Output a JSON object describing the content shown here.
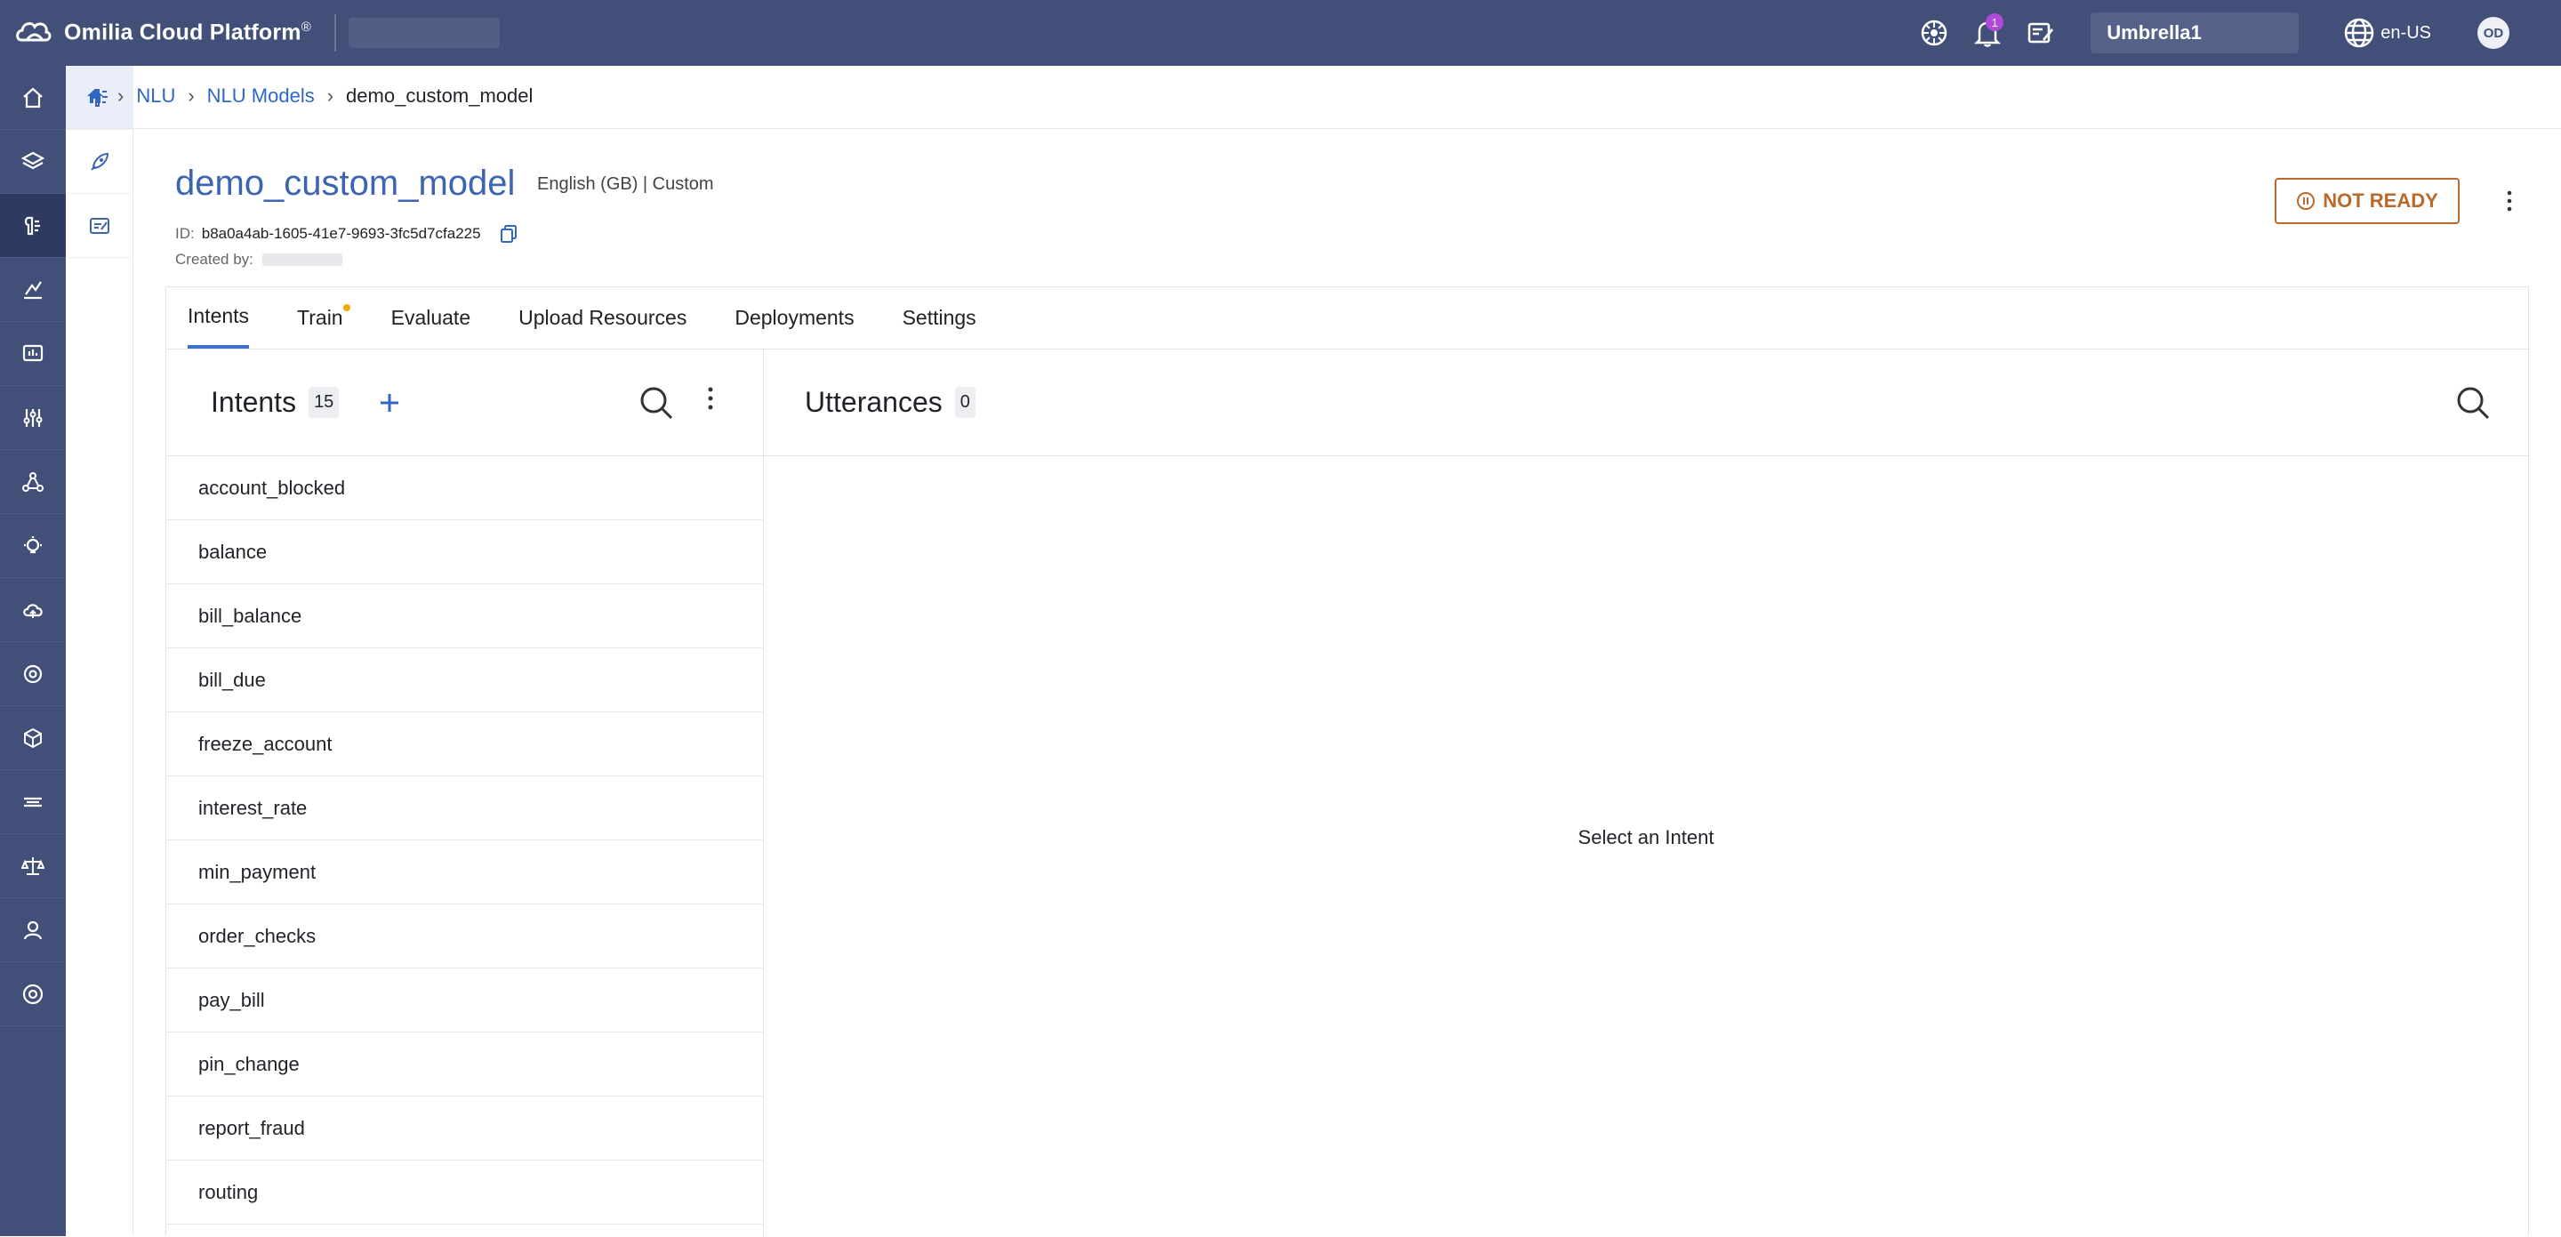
{
  "topbar": {
    "brand": "Omilia Cloud Platform",
    "brand_mark": "®",
    "notification_count": "1",
    "tenant": "Umbrella1",
    "language": "en-US",
    "avatar_initials": "OD"
  },
  "breadcrumb": {
    "items": [
      "NLU",
      "NLU Models"
    ],
    "current": "demo_custom_model"
  },
  "model": {
    "name": "demo_custom_model",
    "meta": "English (GB) | Custom",
    "id_label": "ID:",
    "id": "b8a0a4ab-1605-41e7-9693-3fc5d7cfa225",
    "created_label": "Created by:",
    "status": "NOT READY"
  },
  "tabs": [
    "Intents",
    "Train",
    "Evaluate",
    "Upload Resources",
    "Deployments",
    "Settings"
  ],
  "intents": {
    "title": "Intents",
    "count": "15",
    "items": [
      "account_blocked",
      "balance",
      "bill_balance",
      "bill_due",
      "freeze_account",
      "interest_rate",
      "min_payment",
      "order_checks",
      "pay_bill",
      "pin_change",
      "report_fraud",
      "routing"
    ]
  },
  "utterances": {
    "title": "Utterances",
    "count": "0",
    "empty_message": "Select an Intent"
  },
  "colors": {
    "nav_bg": "#424f78",
    "accent": "#3d63b3",
    "status": "#b8692b",
    "notification": "#b04ad8"
  }
}
